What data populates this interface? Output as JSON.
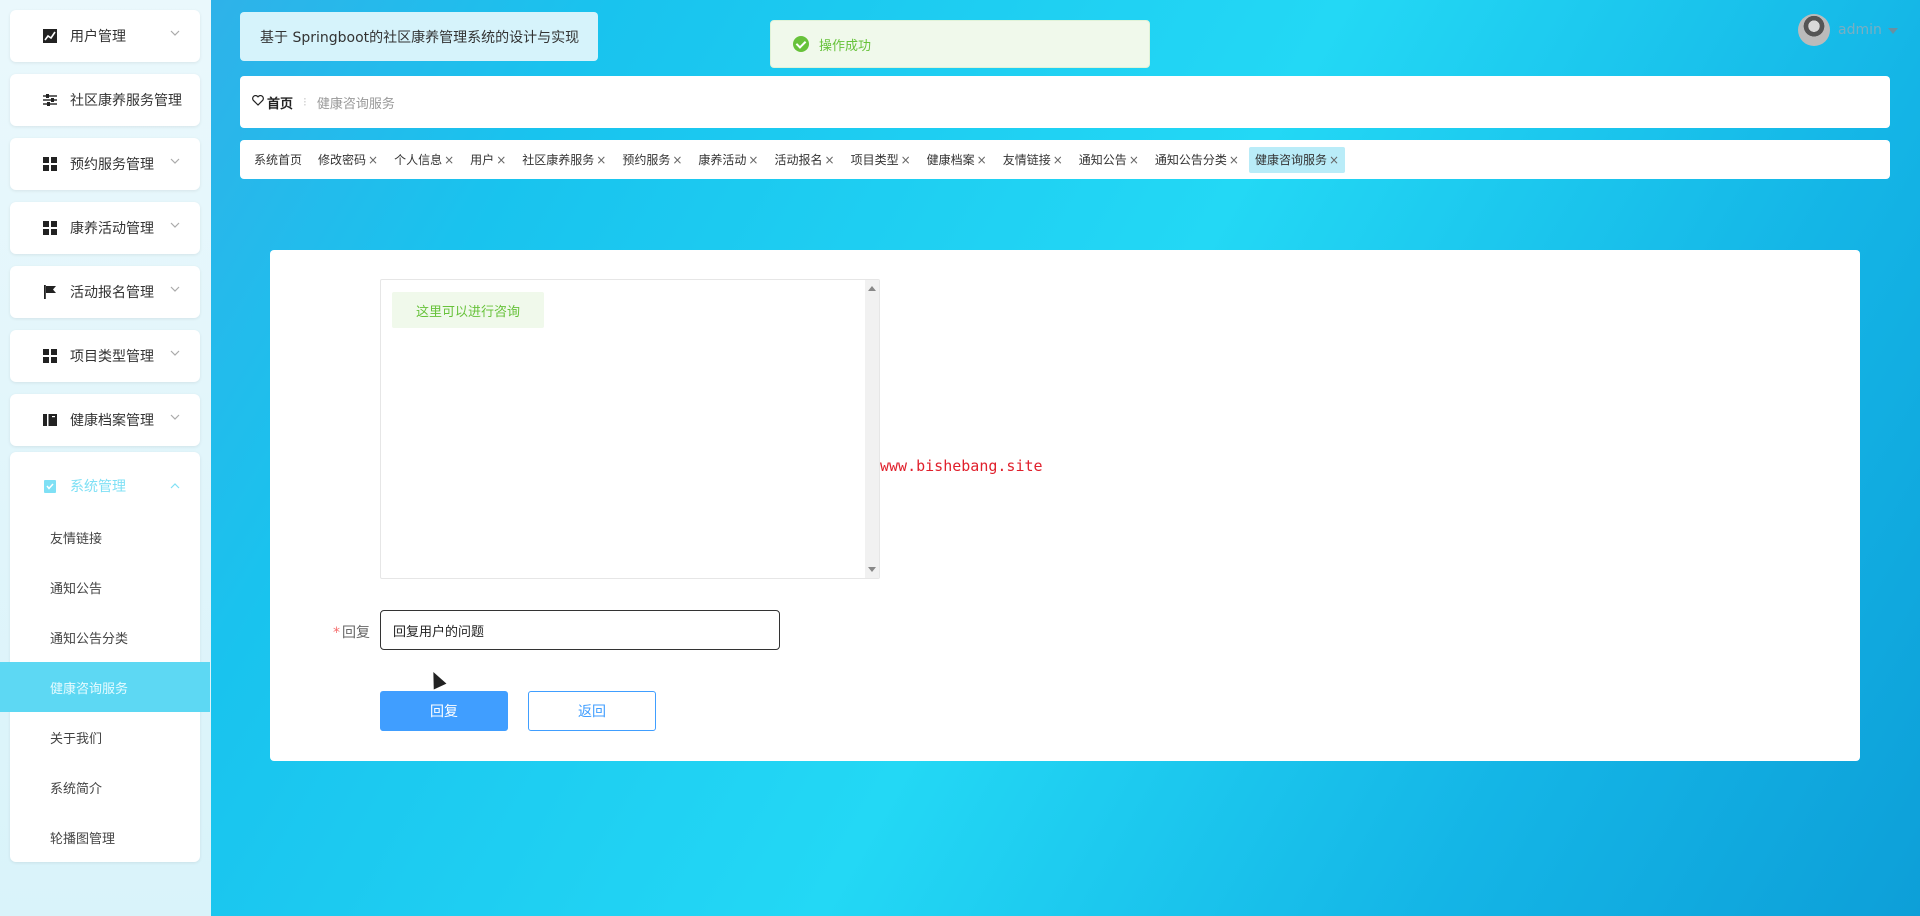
{
  "sidebar": {
    "items": [
      {
        "label": "用户管理",
        "icon": "chart-line-icon"
      },
      {
        "label": "社区康养服务管理",
        "icon": "sliders-icon"
      },
      {
        "label": "预约服务管理",
        "icon": "grid-icon"
      },
      {
        "label": "康养活动管理",
        "icon": "grid-icon"
      },
      {
        "label": "活动报名管理",
        "icon": "flag-icon"
      },
      {
        "label": "项目类型管理",
        "icon": "grid-icon"
      },
      {
        "label": "健康档案管理",
        "icon": "book-icon"
      }
    ],
    "system_group": {
      "label": "系统管理",
      "icon": "clipboard-check-icon",
      "subitems": [
        {
          "label": "友情链接"
        },
        {
          "label": "通知公告"
        },
        {
          "label": "通知公告分类"
        },
        {
          "label": "健康咨询服务"
        },
        {
          "label": "关于我们"
        },
        {
          "label": "系统简介"
        },
        {
          "label": "轮播图管理"
        }
      ]
    }
  },
  "header": {
    "title": "基于 Springboot的社区康养管理系统的设计与实现",
    "toast": "操作成功",
    "user": "admin"
  },
  "breadcrumb": {
    "home": "首页",
    "separator": "⁝",
    "current": "健康咨询服务"
  },
  "tags": [
    {
      "label": "系统首页",
      "closable": false
    },
    {
      "label": "修改密码",
      "closable": true
    },
    {
      "label": "个人信息",
      "closable": true
    },
    {
      "label": "用户",
      "closable": true
    },
    {
      "label": "社区康养服务",
      "closable": true
    },
    {
      "label": "预约服务",
      "closable": true
    },
    {
      "label": "康养活动",
      "closable": true
    },
    {
      "label": "活动报名",
      "closable": true
    },
    {
      "label": "项目类型",
      "closable": true
    },
    {
      "label": "健康档案",
      "closable": true
    },
    {
      "label": "友情链接",
      "closable": true
    },
    {
      "label": "通知公告",
      "closable": true
    },
    {
      "label": "通知公告分类",
      "closable": true
    },
    {
      "label": "健康咨询服务",
      "closable": true,
      "active": true
    }
  ],
  "tag_close_glyph": "×",
  "form": {
    "chat_message": "这里可以进行咨询",
    "watermark": "www.bishebang.site",
    "reply_required_mark": "*",
    "reply_label": "回复",
    "reply_value": "回复用户的问题",
    "submit_label": "回复",
    "back_label": "返回"
  },
  "colors": {
    "accent": "#409eff",
    "success": "#67c23a",
    "active_menu": "#5dd8f3",
    "watermark": "#e0202c"
  }
}
